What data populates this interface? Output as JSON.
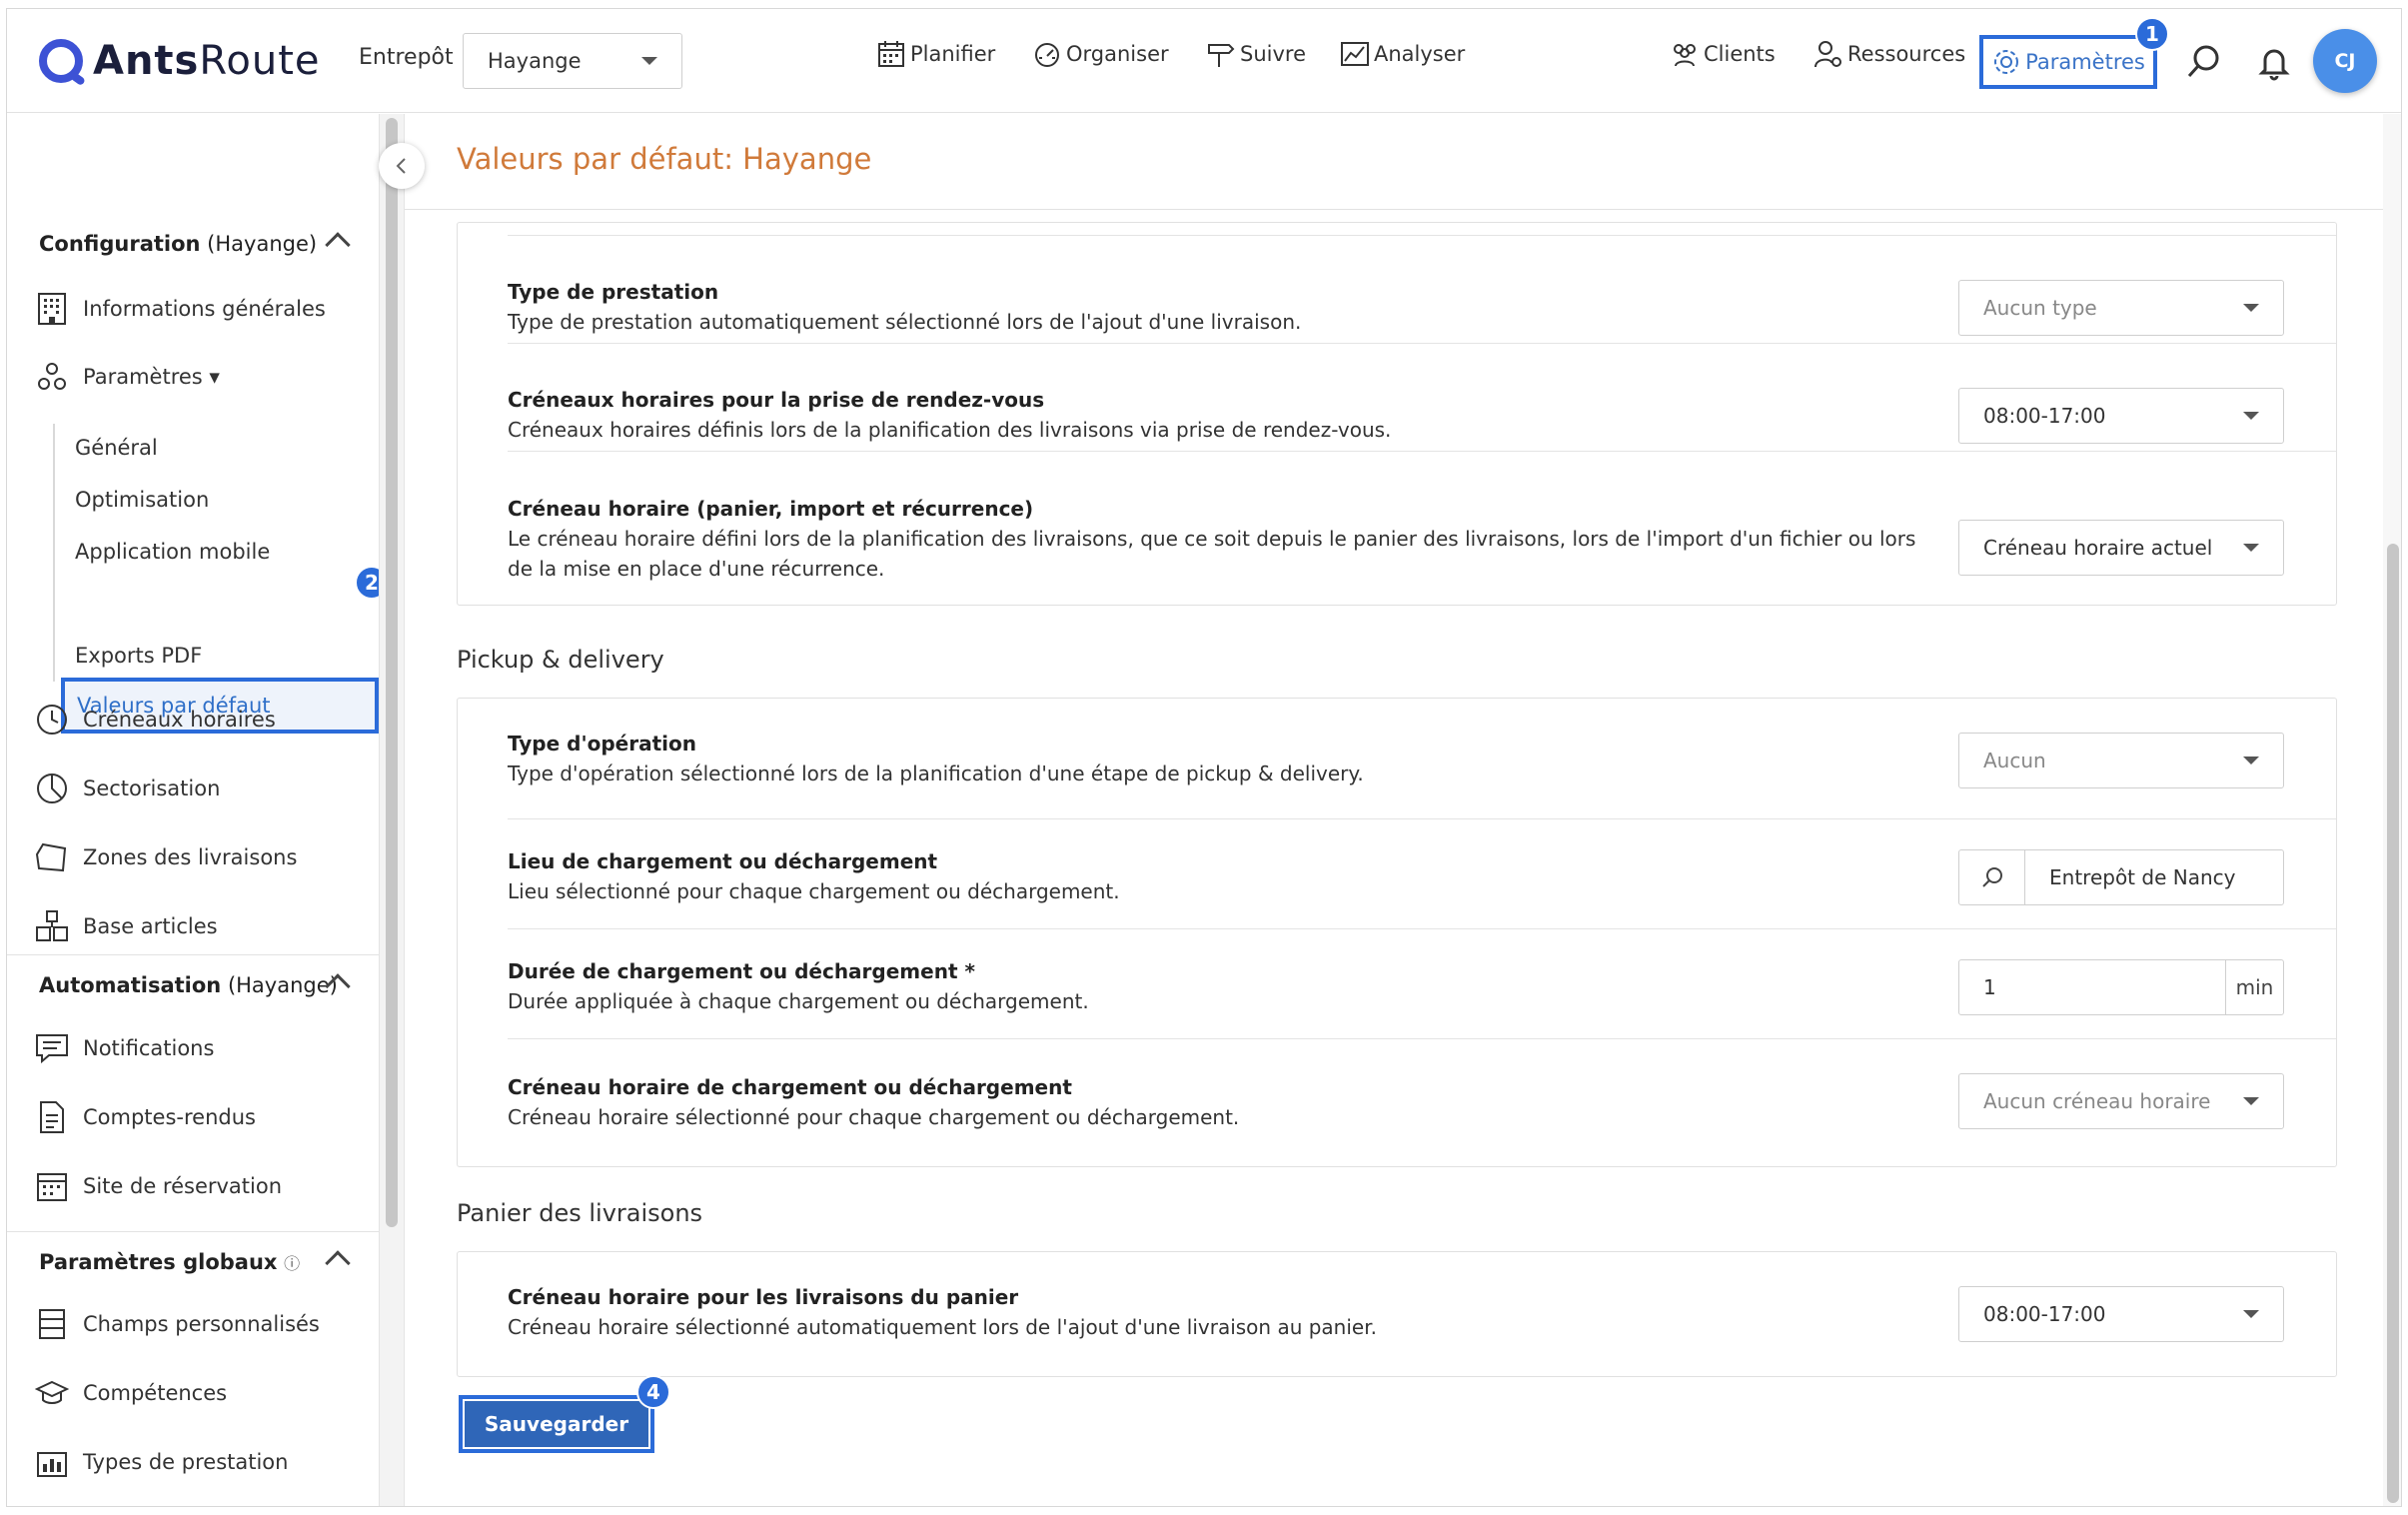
{
  "app": {
    "brand_bold": "Ants",
    "brand_light": "Route"
  },
  "header": {
    "warehouse_label": "Entrepôt",
    "warehouse_value": "Hayange",
    "nav": {
      "planifier": "Planifier",
      "organiser": "Organiser",
      "suivre": "Suivre",
      "analyser": "Analyser",
      "clients": "Clients",
      "ressources": "Ressources",
      "parametres": "Paramètres"
    },
    "avatar_initials": "CJ"
  },
  "annotations": {
    "b1": "1",
    "b2": "2",
    "b4": "4"
  },
  "sidebar": {
    "config_title": "Configuration",
    "config_suffix": "(Hayange)",
    "items": {
      "infos": "Informations générales",
      "parametres": "Paramètres ▾",
      "general": "Général",
      "optimisation": "Optimisation",
      "mobile": "Application mobile",
      "valeurs": "Valeurs par défaut",
      "exports": "Exports PDF",
      "creneaux": "Créneaux horaires",
      "sectorisation": "Sectorisation",
      "zones": "Zones des livraisons",
      "articles": "Base articles"
    },
    "auto_title": "Automatisation",
    "auto_suffix": "(Hayange)",
    "auto_items": {
      "notifications": "Notifications",
      "comptes": "Comptes-rendus",
      "reservation": "Site de réservation"
    },
    "global_title": "Paramètres globaux",
    "global_info": "ⓘ",
    "global_items": {
      "champs": "Champs personnalisés",
      "competences": "Compétences",
      "types": "Types de prestation"
    }
  },
  "main": {
    "title": "Valeurs par défaut: Hayange",
    "rows1": [
      {
        "title": "Type de prestation",
        "desc": "Type de prestation automatiquement sélectionné lors de l'ajout d'une livraison.",
        "value": "Aucun type"
      },
      {
        "title": "Créneaux horaires pour la prise de rendez-vous",
        "desc": "Créneaux horaires définis lors de la planification des livraisons via prise de rendez-vous.",
        "value": "08:00-17:00"
      },
      {
        "title": "Créneau horaire (panier, import et récurrence)",
        "desc": "Le créneau horaire défini lors de la planification des livraisons, que ce soit depuis le panier des livraisons, lors de l'import d'un fichier ou lors de la mise en place d'une récurrence.",
        "value": "Créneau horaire actuel"
      }
    ],
    "section_pickup": "Pickup & delivery",
    "rows2": [
      {
        "title": "Type d'opération",
        "desc": "Type d'opération sélectionné lors de la planification d'une étape de pickup & delivery.",
        "value": "Aucun"
      },
      {
        "title": "Lieu de chargement ou déchargement",
        "desc": "Lieu sélectionné pour chaque chargement ou déchargement.",
        "value": "Entrepôt de Nancy"
      },
      {
        "title": "Durée de chargement ou déchargement *",
        "desc": "Durée appliquée à chaque chargement ou déchargement.",
        "value": "1",
        "unit": "min"
      },
      {
        "title": "Créneau horaire de chargement ou déchargement",
        "desc": "Créneau horaire sélectionné pour chaque chargement ou déchargement.",
        "value": "Aucun créneau horaire"
      }
    ],
    "section_panier": "Panier des livraisons",
    "rows3": [
      {
        "title": "Créneau horaire pour les livraisons du panier",
        "desc": "Créneau horaire sélectionné automatiquement lors de l'ajout d'une livraison au panier.",
        "value": "08:00-17:00"
      }
    ],
    "save_label": "Sauvegarder"
  }
}
